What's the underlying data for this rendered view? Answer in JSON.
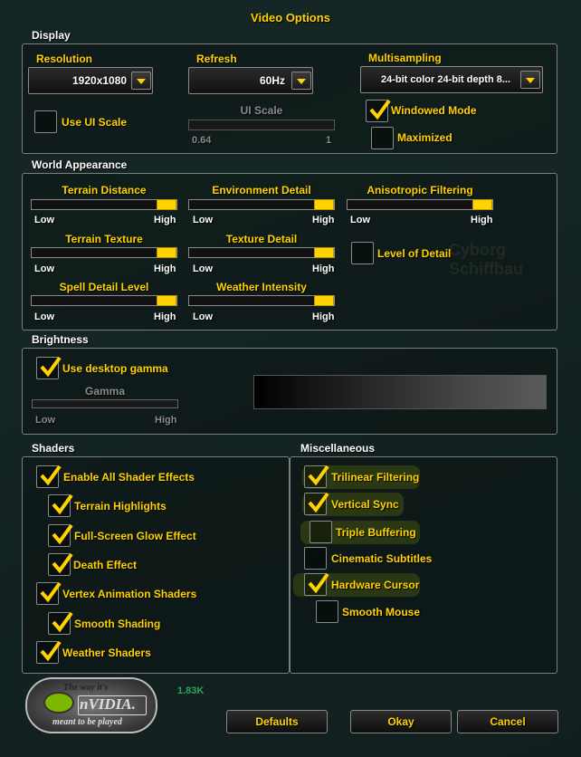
{
  "window": {
    "title": "Video Options"
  },
  "display": {
    "section_label": "Display",
    "resolution": {
      "label": "Resolution",
      "value": "1920x1080"
    },
    "refresh": {
      "label": "Refresh",
      "value": "60Hz"
    },
    "multisampling": {
      "label": "Multisampling",
      "value": "24-bit color 24-bit depth 8..."
    },
    "use_ui_scale": {
      "label": "Use UI Scale",
      "checked": false
    },
    "ui_scale": {
      "label": "UI Scale",
      "min": "0.64",
      "max": "1",
      "value": 1
    },
    "windowed_mode": {
      "label": "Windowed Mode",
      "checked": true
    },
    "maximized": {
      "label": "Maximized",
      "checked": false
    }
  },
  "world_appearance": {
    "section_label": "World Appearance",
    "sliders": [
      {
        "label": "Terrain Distance",
        "low": "Low",
        "high": "High",
        "value": 1
      },
      {
        "label": "Environment Detail",
        "low": "Low",
        "high": "High",
        "value": 1
      },
      {
        "label": "Anisotropic Filtering",
        "low": "Low",
        "high": "High",
        "value": 1
      },
      {
        "label": "Terrain Texture",
        "low": "Low",
        "high": "High",
        "value": 1
      },
      {
        "label": "Texture Detail",
        "low": "Low",
        "high": "High",
        "value": 1
      },
      {
        "label": "Spell Detail Level",
        "low": "Low",
        "high": "High",
        "value": 1
      },
      {
        "label": "Weather Intensity",
        "low": "Low",
        "high": "High",
        "value": 1
      }
    ],
    "level_of_detail": {
      "label": "Level of Detail",
      "checked": false
    },
    "bg_text": "Cyborg Schiffbau"
  },
  "brightness": {
    "section_label": "Brightness",
    "use_desktop_gamma": {
      "label": "Use desktop gamma",
      "checked": true
    },
    "gamma": {
      "label": "Gamma",
      "low": "Low",
      "high": "High"
    }
  },
  "shaders": {
    "section_label": "Shaders",
    "items": [
      {
        "label": "Enable All Shader Effects",
        "checked": true
      },
      {
        "label": "Terrain Highlights",
        "checked": true
      },
      {
        "label": "Full-Screen Glow Effect",
        "checked": true
      },
      {
        "label": "Death Effect",
        "checked": true
      },
      {
        "label": "Vertex Animation Shaders",
        "checked": true
      },
      {
        "label": "Smooth Shading",
        "checked": true
      },
      {
        "label": "Weather Shaders",
        "checked": true
      }
    ]
  },
  "miscellaneous": {
    "section_label": "Miscellaneous",
    "items": [
      {
        "label": "Trilinear Filtering",
        "checked": true
      },
      {
        "label": "Vertical Sync",
        "checked": true
      },
      {
        "label": "Triple Buffering",
        "checked": false
      },
      {
        "label": "Cinematic Subtitles",
        "checked": false
      },
      {
        "label": "Hardware Cursor",
        "checked": true
      },
      {
        "label": "Smooth Mouse",
        "checked": false
      }
    ]
  },
  "footer": {
    "defaults_label": "Defaults",
    "okay_label": "Okay",
    "cancel_label": "Cancel",
    "fps": "1.83K",
    "logo_line1": "The way it's",
    "logo_brand": "nVIDIA.",
    "logo_line2": "meant to be played"
  },
  "colors": {
    "accent": "#ffd200",
    "panel_border": "#7d7d7d",
    "highlight": "#aac800"
  }
}
